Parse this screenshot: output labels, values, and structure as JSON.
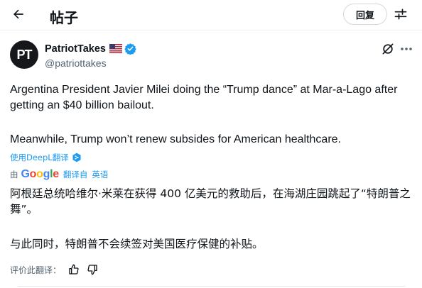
{
  "header": {
    "back_icon": "arrow-left-icon",
    "title": "帖子",
    "reply_label": "回复",
    "adjust_icon": "sliders-icon"
  },
  "post": {
    "author": {
      "avatar_text": "PT",
      "name": "PatriotTakes",
      "flag_icon": "us-flag-icon",
      "verified_icon": "verified-badge-icon",
      "verified_color": "#1d9bf0",
      "handle": "@patriottakes"
    },
    "text_lines": [
      "Argentina President Javier Milei doing the “Trump dance” at Mar-a-Lago after getting an $40 billion bailout.",
      "Meanwhile, Trump won’t renew subsides for American healthcare."
    ],
    "deepl_label": "使用DeepL翻译",
    "translation": {
      "by_label": "由",
      "provider": "Google",
      "translated_from_label": "翻译自",
      "source_language": "英语",
      "lines": [
        "阿根廷总统哈维尔·米莱在获得 400 亿美元的救助后，在海湖庄园跳起了“特朗普之舞”。",
        "与此同时，特朗普不会续签对美国医疗保健的补贴。"
      ],
      "rate_label": "评价此翻译："
    }
  },
  "colors": {
    "accent": "#1d9bf0",
    "text": "#0f1419",
    "secondary": "#536471"
  }
}
